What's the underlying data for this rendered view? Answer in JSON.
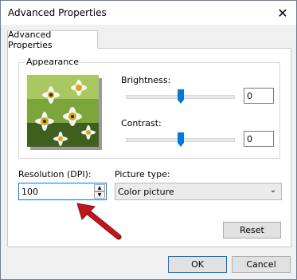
{
  "window": {
    "title": "Advanced Properties",
    "close_icon": "close-icon"
  },
  "tabs": [
    {
      "label": "Advanced Properties",
      "selected": true
    }
  ],
  "appearance": {
    "legend": "Appearance",
    "image_icon": "flower-photo",
    "brightness": {
      "label": "Brightness:",
      "value": "0",
      "slider_level": 0.5
    },
    "contrast": {
      "label": "Contrast:",
      "value": "0",
      "slider_level": 0.5
    }
  },
  "resolution": {
    "label": "Resolution (DPI):",
    "value": "100"
  },
  "picture_type": {
    "label": "Picture type:",
    "selected": "Color picture"
  },
  "buttons": {
    "reset": "Reset",
    "ok": "OK",
    "cancel": "Cancel"
  },
  "colors": {
    "accent": "#0078d7",
    "annotation_arrow": "#c0151b"
  }
}
